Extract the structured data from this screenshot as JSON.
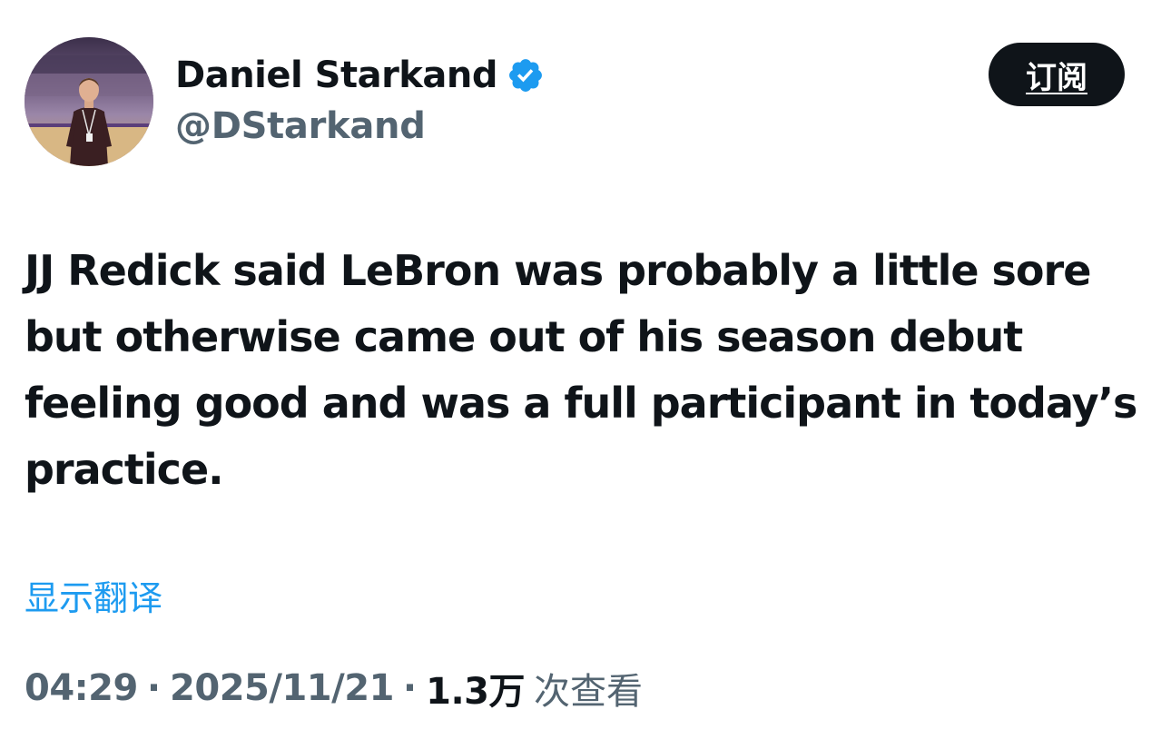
{
  "author": {
    "display_name": "Daniel Starkand",
    "handle": "@DStarkand",
    "verified": true
  },
  "subscribe_button": {
    "label": "订阅"
  },
  "tweet": {
    "text": "JJ Redick said LeBron was probably a little sore but otherwise came out of his season debut feeling good and was a full participant in today’s practice.",
    "translate_label": "显示翻译"
  },
  "meta": {
    "time": "04:29",
    "separator": "·",
    "date": "2025/11/21",
    "views_count": "1.3万",
    "views_label": "次查看"
  },
  "icons": {
    "verified": "verified-badge-icon"
  },
  "colors": {
    "text_primary": "#0f1419",
    "text_secondary": "#536471",
    "link": "#1d9bf0",
    "verified": "#1d9bf0",
    "button_bg": "#0f1419",
    "button_text": "#ffffff",
    "background": "#ffffff"
  }
}
